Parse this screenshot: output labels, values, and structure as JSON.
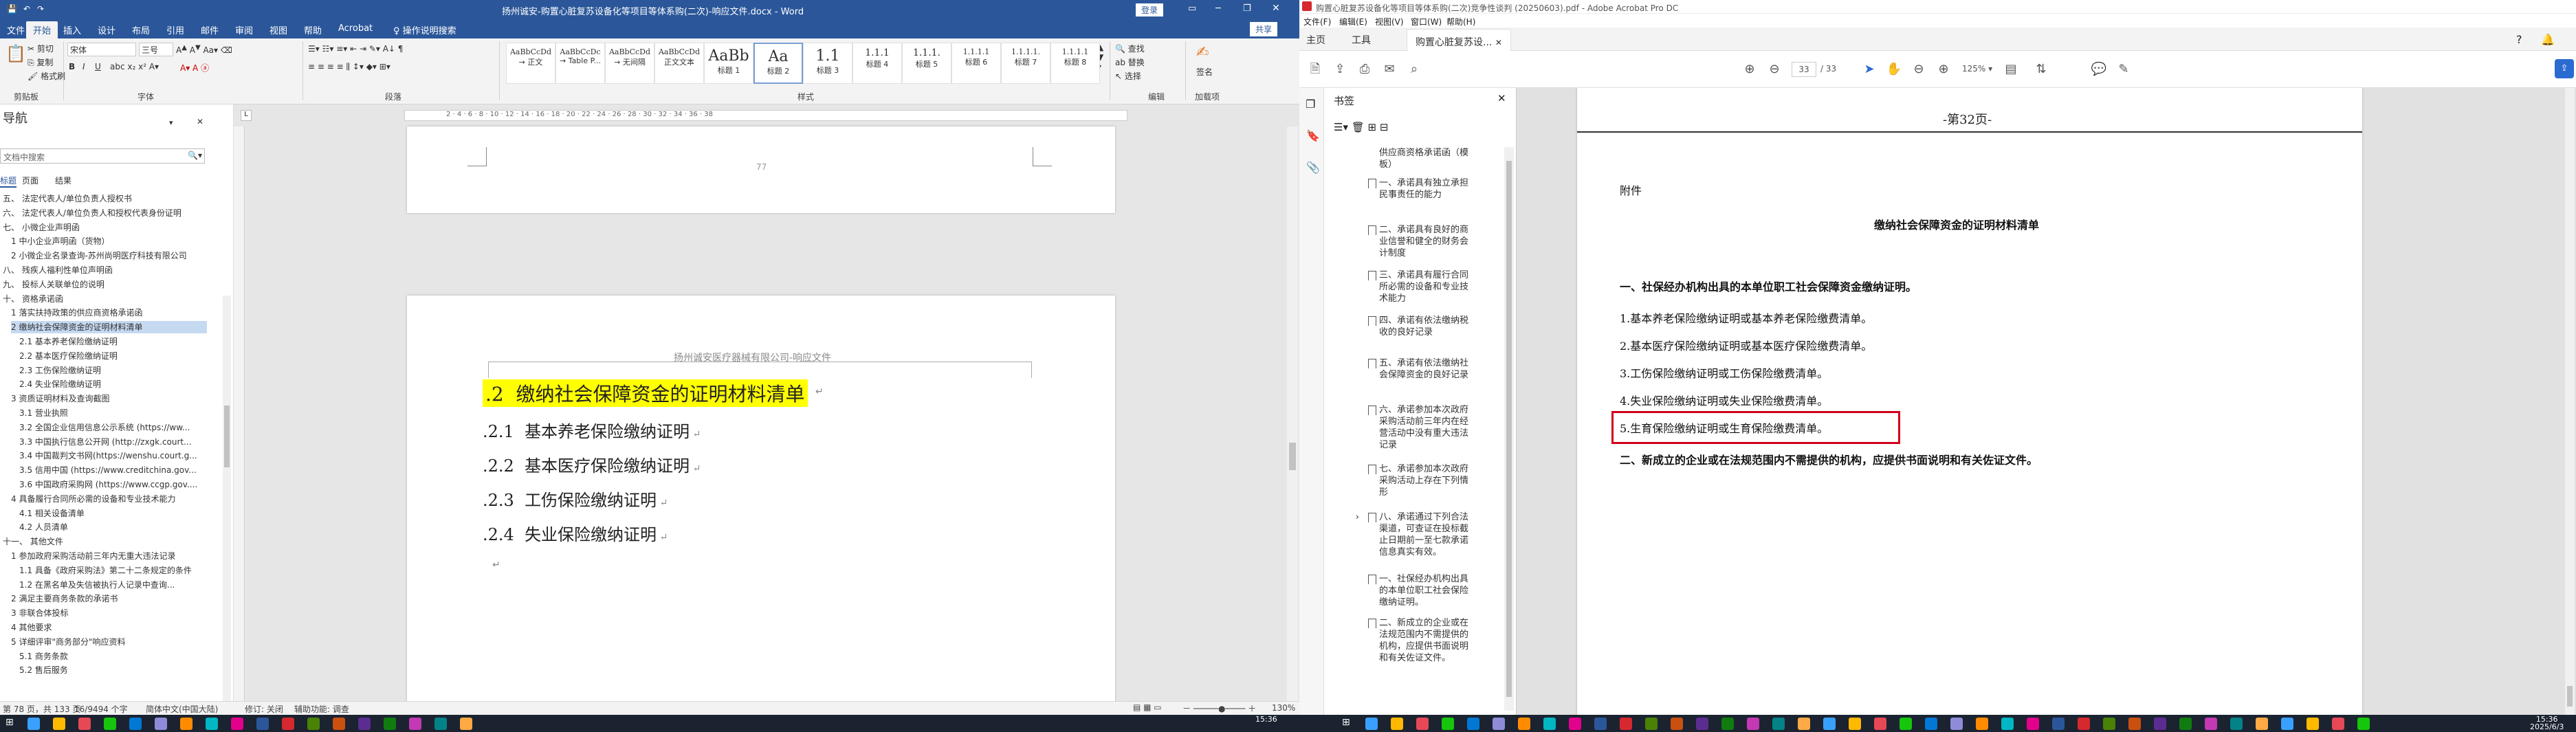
{
  "word": {
    "title": "扬州诚安-购置心脏复苏设备化等项目等体系购(二次)-响应文件.docx - Word",
    "signin": "登录",
    "tabs": [
      "文件",
      "开始",
      "插入",
      "设计",
      "布局",
      "引用",
      "邮件",
      "审阅",
      "视图",
      "帮助",
      "Acrobat",
      "♀ 操作说明搜索"
    ],
    "share": "共享",
    "clipboard": {
      "cut": "剪切",
      "copy": "复制",
      "format": "格式刷",
      "group": "剪贴板"
    },
    "font": {
      "name": "宋体",
      "size": "三号",
      "group": "字体"
    },
    "paragraph_group": "段落",
    "styles": [
      {
        "preview": "AaBbCcDd",
        "label": "→ 正文"
      },
      {
        "preview": "AaBbCcDc",
        "label": "→ Table P..."
      },
      {
        "preview": "AaBbCcDd",
        "label": "→ 无间隔"
      },
      {
        "preview": "AaBbCcDd",
        "label": "正文文本"
      },
      {
        "preview": "AaBb",
        "label": "标题 1"
      },
      {
        "preview": "Aa",
        "label": "标题 2"
      },
      {
        "preview": "1.1",
        "label": "标题 3"
      },
      {
        "preview": "1.1.1",
        "label": "标题 4"
      },
      {
        "preview": "1.1.1.",
        "label": "标题 5"
      },
      {
        "preview": "1.1.1.1",
        "label": "标题 6"
      },
      {
        "preview": "1.1.1.1.",
        "label": "标题 7"
      },
      {
        "preview": "1.1.1.1",
        "label": "标题 8"
      }
    ],
    "styles_group": "样式",
    "editing": {
      "find": "查找",
      "replace": "替换",
      "select": "选择",
      "group": "编辑"
    },
    "acrobat_group": {
      "label": "签名",
      "sub": "加载项"
    },
    "nav": {
      "title": "导航",
      "search_placeholder": "文档中搜索",
      "tabs": [
        "标题",
        "页面",
        "结果"
      ],
      "items": [
        "五、 法定代表人/单位负责人授权书",
        "六、 法定代表人/单位负责人和授权代表身份证明",
        "七、 小微企业声明函",
        "1 中小企业声明函（货物）",
        "2 小微企业名录查询-苏州尚明医疗科技有限公司",
        "八、 残疾人福利性单位声明函",
        "九、 投标人关联单位的说明",
        "十、 资格承诺函",
        "1 落实扶持政策的供应商资格承诺函",
        "2 缴纳社会保障资金的证明材料清单",
        "2.1 基本养老保险缴纳证明",
        "2.2 基本医疗保险缴纳证明",
        "2.3 工伤保险缴纳证明",
        "2.4 失业保险缴纳证明",
        "3 资质证明材料及查询截图",
        "3.1 营业执照",
        "3.2 全国企业信用信息公示系统 (https://ww...",
        "3.3 中国执行信息公开网 (http://zxgk.court...",
        "3.4 中国裁判文书网(https://wenshu.court.g...",
        "3.5 信用中国 (https://www.creditchina.gov...",
        "3.6 中国政府采购网 (https://www.ccgp.gov....",
        "4 具备履行合同所必需的设备和专业技术能力",
        "4.1 相关设备清单",
        "4.2 人员清单",
        "十一、 其他文件",
        "1 参加政府采购活动前三年内无重大违法记录",
        "1.1 具备《政府采购法》第二十二条规定的条件",
        "1.2 在黑名单及失信被执行人记录中查询...",
        "2 满足主要商务条款的承诺书",
        "3 非联合体投标",
        "4 其他要求",
        "5 详细评审\"商务部分\"响应资料",
        "5.1 商务条款",
        "5.2 售后服务"
      ],
      "selected_index": 9
    },
    "ruler_text": "2 · 4 · 6 · 8 · 10 · 12 · 14 · 16 · 18 · 20 · 22 · 24 · 26 · 28 · 30 · 32 · 34 · 36 · 38",
    "page1_mark": "77",
    "page2_header": "扬州诚安医疗器械有限公司-响应文件",
    "headings": [
      {
        "num": ".2",
        "text": "缴纳社会保障资金的证明材料清单",
        "level": 1
      },
      {
        "num": ".2.1",
        "text": "基本养老保险缴纳证明",
        "level": 2
      },
      {
        "num": ".2.2",
        "text": "基本医疗保险缴纳证明",
        "level": 2
      },
      {
        "num": ".2.3",
        "text": "工伤保险缴纳证明",
        "level": 2
      },
      {
        "num": ".2.4",
        "text": "失业保险缴纳证明",
        "level": 2
      }
    ],
    "status": {
      "page": "第 78 页，共 133 页",
      "words": "16/9494 个字",
      "lang": "简体中文(中国大陆)",
      "insert": "修订: 关闭",
      "access": "辅助功能: 调查",
      "zoom": "130%"
    }
  },
  "acrobat": {
    "title": "购置心脏复苏设备化等项目等体系购(二次)竞争性谈判 (20250603).pdf - Adobe Acrobat Pro DC",
    "menu": [
      "文件(F)",
      "编辑(E)",
      "视图(V)",
      "窗口(W)",
      "帮助(H)"
    ],
    "tabs": [
      "主页",
      "工具",
      "购置心脏复苏设..."
    ],
    "page_current": "33",
    "page_total": "/ 33",
    "zoom": "125%",
    "bookmarks_title": "书签",
    "bookmarks": [
      "供应商资格承诺函（模板）",
      "一、承诺具有独立承担民事责任的能力",
      "二、承诺具有良好的商业信誉和健全的财务会计制度",
      "三、承诺具有履行合同所必需的设备和专业技术能力",
      "四、承诺有依法缴纳税收的良好记录",
      "五、承诺有依法缴纳社会保障资金的良好记录",
      "六、承诺参加本次政府采购活动前三年内在经营活动中没有重大违法记录",
      "七、承诺参加本次政府采购活动上存在下列情形",
      "八、承诺通过下列合法渠道，可查证在投标截止日期前一至七款承诺信息真实有效。",
      "一、社保经办机构出具的本单位职工社会保险缴纳证明。",
      "二、新成立的企业或在法规范围内不需提供的机构，应提供书面说明和有关佐证文件。"
    ],
    "page_label": "-第32页-",
    "attachment": "附件",
    "doc_title": "缴纳社会保障资金的证明材料清单",
    "section1": "一、社保经办机构出具的本单位职工社会保障资金缴纳证明。",
    "list": [
      "1.基本养老保险缴纳证明或基本养老保险缴费清单。",
      "2.基本医疗保险缴纳证明或基本医疗保险缴费清单。",
      "3.工伤保险缴纳证明或工伤保险缴费清单。",
      "4.失业保险缴纳证明或失业保险缴费清单。",
      "5.生育保险缴纳证明或生育保险缴费清单。"
    ],
    "highlighted_index": 4,
    "section2": "二、新成立的企业或在法规范围内不需提供的机构，应提供书面说明和有关佐证文件。",
    "highlight_color": "#d0021b"
  },
  "taskbar": {
    "time": "15:36",
    "date": "2025/6/3"
  }
}
